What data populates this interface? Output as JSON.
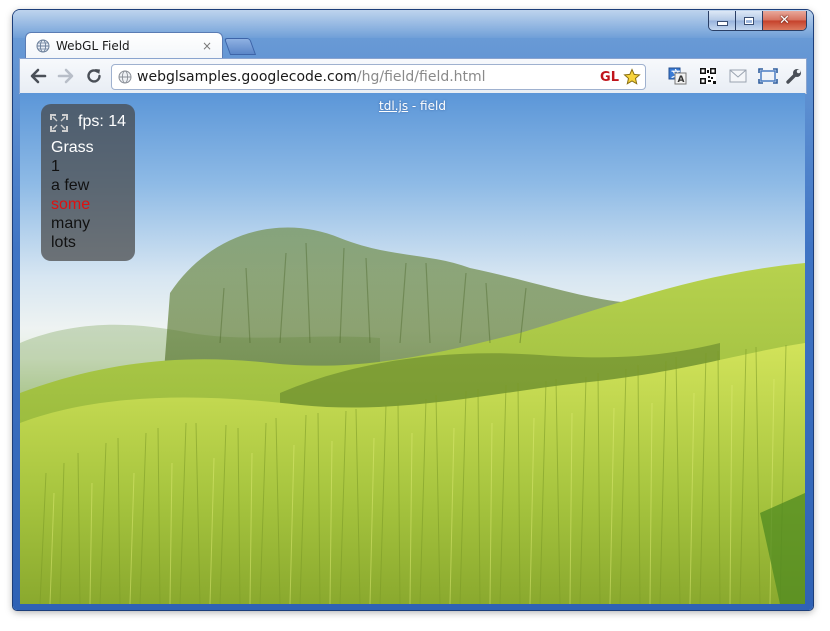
{
  "window": {
    "caption_buttons": {
      "minimize_icon": "minimize-icon",
      "maximize_icon": "maximize-icon",
      "close_glyph": "✕"
    }
  },
  "tabs": [
    {
      "title": "WebGL Field",
      "icon": "globe-icon",
      "close_glyph": "×",
      "active": true
    }
  ],
  "toolbar": {
    "back_icon": "back-arrow-icon",
    "forward_icon": "forward-arrow-icon",
    "reload_icon": "reload-icon",
    "omnibox": {
      "url_host": "webglsamples.googlecode.com",
      "url_path": "/hg/field/field.html",
      "gl_badge": "GL",
      "star_icon": "bookmark-star-icon"
    },
    "extensions": [
      "translate-icon",
      "qr-code-icon",
      "mail-icon",
      "fullscreen-icon",
      "wrench-icon"
    ]
  },
  "page": {
    "link_text": "tdl.js",
    "link_suffix": " - field",
    "hud": {
      "fullscreen_icon": "fullscreen-toggle-icon",
      "fps_label": "fps: 14",
      "menu_title": "Grass",
      "options": [
        "1",
        "a few",
        "some",
        "many",
        "lots"
      ],
      "selected_option": "some",
      "selected_color": "#e01010"
    }
  }
}
